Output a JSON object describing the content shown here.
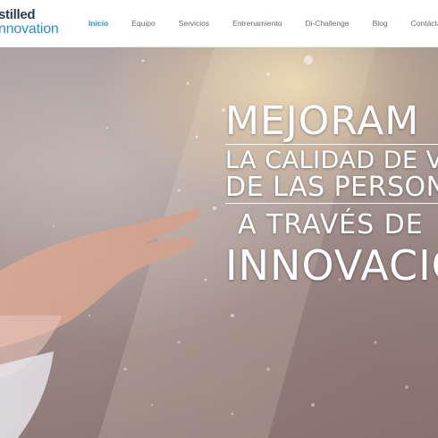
{
  "header": {
    "logo": {
      "top_text": "stilled",
      "bottom_text": "nnovation",
      "colors": {
        "top": "#2c3d4f",
        "bottom": "#2a8fd0"
      }
    },
    "nav": {
      "items": [
        {
          "label": "Inicio",
          "active": true
        },
        {
          "label": "Equipo",
          "active": false
        },
        {
          "label": "Servicios",
          "active": false
        },
        {
          "label": "Entrenamiento",
          "active": false
        },
        {
          "label": "Di-Challenge",
          "active": false
        },
        {
          "label": "Blog",
          "active": false
        },
        {
          "label": "Contáctanos",
          "active": false
        }
      ],
      "active_color": "#2a8fd0",
      "text_color": "#6a6a6a"
    }
  },
  "hero": {
    "image": "hands-reaching-toward-sunlight",
    "lines": [
      "MEJORAM",
      "LA CALIDAD DE V",
      "DE LAS PERSON",
      "A TRAVÉS DE",
      "INNOVACIO"
    ],
    "text_color": "#ffffff"
  }
}
